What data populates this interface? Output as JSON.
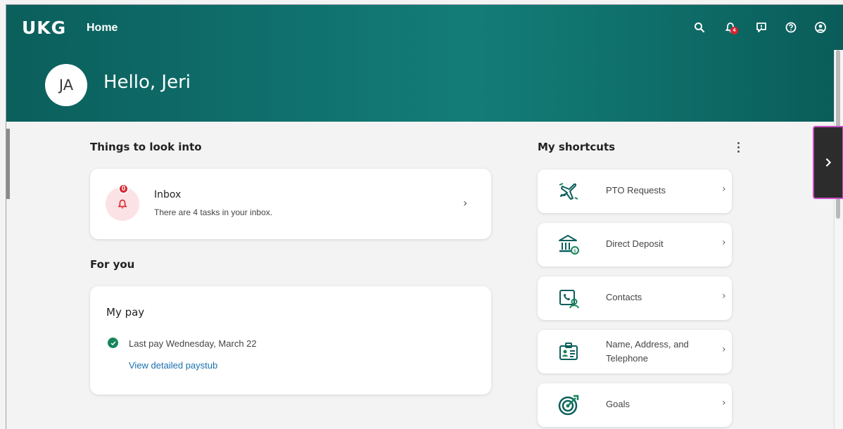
{
  "header": {
    "logo": "UKG",
    "title": "Home",
    "icons": [
      "search-icon",
      "notification-bell-icon",
      "feedback-icon",
      "help-icon",
      "user-profile-icon"
    ],
    "notification_count": "4"
  },
  "user": {
    "initials": "JA",
    "greeting": "Hello, Jeri"
  },
  "look_into": {
    "title": "Things to look into",
    "inbox": {
      "title": "Inbox",
      "subtitle": "There are 4 tasks in your inbox.",
      "badge": "0"
    }
  },
  "for_you": {
    "title": "For you",
    "pay": {
      "title": "My pay",
      "last_pay": "Last pay Wednesday, March 22",
      "link": "View detailed paystub"
    }
  },
  "shortcuts": {
    "title": "My shortcuts",
    "items": [
      {
        "label": "PTO Requests",
        "icon": "airplane-icon"
      },
      {
        "label": "Direct Deposit",
        "icon": "bank-icon"
      },
      {
        "label": "Contacts",
        "icon": "contacts-icon"
      },
      {
        "label": "Name, Address, and Telephone",
        "icon": "id-card-icon"
      },
      {
        "label": "Goals",
        "icon": "target-icon"
      }
    ]
  },
  "colors": {
    "header_teal": "#0f6e6b",
    "accent_green": "#17845a",
    "badge_red": "#d9232e",
    "link_blue": "#1a6fae"
  }
}
